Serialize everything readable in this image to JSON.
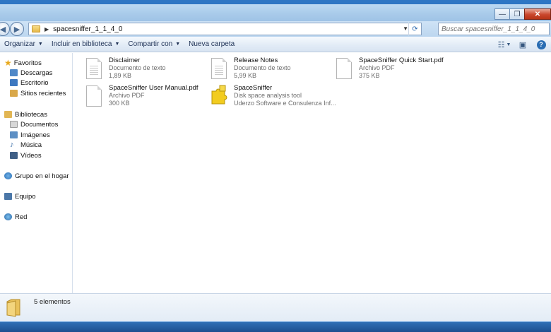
{
  "window": {
    "buttons": {
      "minimize": "—",
      "maximize": "❐",
      "close": "✕"
    }
  },
  "address": {
    "path": "spacesniffer_1_1_4_0",
    "search_placeholder": "Buscar spacesniffer_1_1_4_0"
  },
  "toolbar": {
    "organize": "Organizar",
    "include_library": "Incluir en biblioteca",
    "share_with": "Compartir con",
    "new_folder": "Nueva carpeta"
  },
  "nav": {
    "favorites": "Favoritos",
    "downloads": "Descargas",
    "desktop": "Escritorio",
    "recent": "Sitios recientes",
    "libraries": "Bibliotecas",
    "documents": "Documentos",
    "images": "Imágenes",
    "music": "Música",
    "videos": "Vídeos",
    "homegroup": "Grupo en el hogar",
    "computer": "Equipo",
    "network": "Red"
  },
  "files": [
    {
      "name": "Disclaimer",
      "type": "Documento de texto",
      "size": "1,89 KB"
    },
    {
      "name": "Release Notes",
      "type": "Documento de texto",
      "size": "5,99 KB"
    },
    {
      "name": "SpaceSniffer Quick Start.pdf",
      "type": "Archivo PDF",
      "size": "375 KB"
    },
    {
      "name": "SpaceSniffer User Manual.pdf",
      "type": "Archivo PDF",
      "size": "300 KB"
    },
    {
      "name": "SpaceSniffer",
      "type": "Disk space analysis tool",
      "size": "Uderzo Software e Consulenza Inf..."
    }
  ],
  "status": {
    "count": "5 elementos"
  }
}
